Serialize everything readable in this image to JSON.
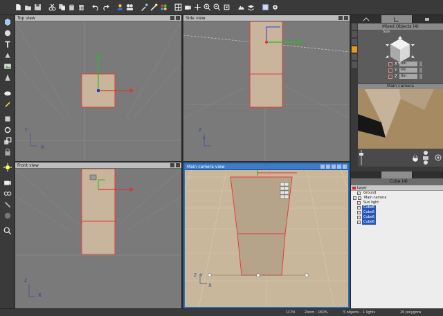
{
  "toolbar": {
    "icons": [
      "new-file-icon",
      "open-file-icon",
      "save-file-icon",
      "cut-icon",
      "copy-icon",
      "paste-icon",
      "delete-icon",
      "undo-icon",
      "redo-icon",
      "people-icon",
      "people-2-icon",
      "paint-icon",
      "magic-wand-icon",
      "palette-icon",
      "grid-icon",
      "camera-icon",
      "pan-icon",
      "zoom-in-icon",
      "zoom-out-icon",
      "fit-icon",
      "render-icon",
      "layers-icon",
      "preview-icon",
      "settings-icon"
    ]
  },
  "viewports": {
    "top": {
      "title": "Top view"
    },
    "side": {
      "title": "Side view"
    },
    "front": {
      "title": "Front view"
    },
    "camera": {
      "title": "Main camera view"
    }
  },
  "axes": {
    "x": "X",
    "y": "Y",
    "z": "Z"
  },
  "object_panel": {
    "title": "Mixed Objects (4)",
    "size_label": "Size",
    "rows": [
      {
        "axis": "X",
        "value": "0m"
      },
      {
        "axis": "Y",
        "value": "0m"
      },
      {
        "axis": "Z",
        "value": "0m"
      }
    ]
  },
  "camera_panel": {
    "title": "Main camera"
  },
  "scene_panel": {
    "selector": "Cube (4)",
    "layer": "Layer",
    "items": [
      {
        "label": "Ground",
        "selected": false
      },
      {
        "label": "Main camera",
        "selected": false
      },
      {
        "label": "Sun light",
        "selected": false
      },
      {
        "label": "Cube6",
        "selected": true
      },
      {
        "label": "Cube6",
        "selected": true
      },
      {
        "label": "Cube6",
        "selected": true
      },
      {
        "label": "Cube6",
        "selected": true
      }
    ]
  },
  "status": {
    "cpu": "1CPU",
    "zoom": "Zoom : 160%",
    "objects": "5 objects - 1 lights",
    "polygons": "26 polygons"
  },
  "colors": {
    "accent": "#2c6fbf",
    "axis_x": "#e03030",
    "axis_y": "#22c022",
    "axis_z": "#2a3bd8",
    "object_fill": "#c8b59c",
    "object_edge": "#e23c3c"
  }
}
